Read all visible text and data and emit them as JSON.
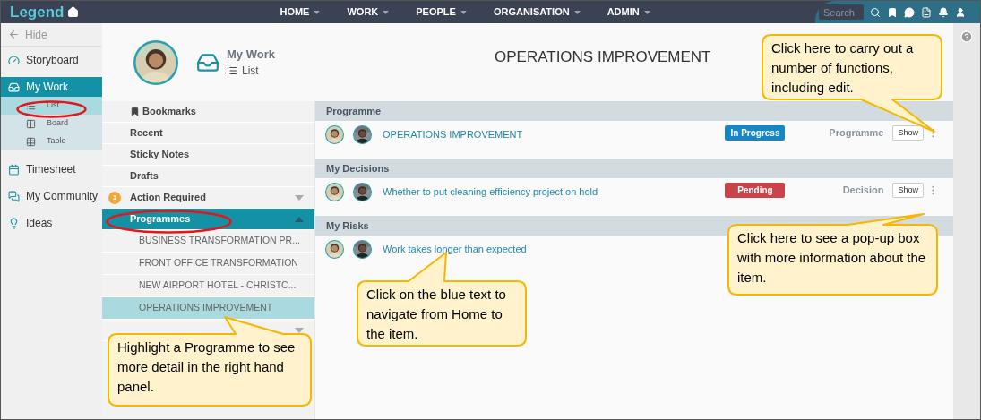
{
  "app": {
    "logo": "Legend"
  },
  "top_nav": [
    {
      "label": "HOME"
    },
    {
      "label": "WORK"
    },
    {
      "label": "PEOPLE"
    },
    {
      "label": "ORGANISATION"
    },
    {
      "label": "ADMIN"
    }
  ],
  "search": {
    "placeholder": "Search"
  },
  "sidebar": {
    "hide": "Hide",
    "items": [
      {
        "label": "Storyboard",
        "selected": false
      },
      {
        "label": "My Work",
        "selected": true,
        "children": [
          {
            "label": "List",
            "selected": true
          },
          {
            "label": "Board",
            "selected": false
          },
          {
            "label": "Table",
            "selected": false
          }
        ]
      },
      {
        "label": "Timesheet",
        "selected": false
      },
      {
        "label": "My Community",
        "selected": false
      },
      {
        "label": "Ideas",
        "selected": false
      }
    ]
  },
  "header": {
    "title": "My Work",
    "subtitle": "List",
    "page_title": "OPERATIONS IMPROVEMENT"
  },
  "nav_list": [
    {
      "kind": "bookmark",
      "label": "Bookmarks"
    },
    {
      "kind": "plain",
      "label": "Recent"
    },
    {
      "kind": "plain",
      "label": "Sticky Notes"
    },
    {
      "kind": "plain",
      "label": "Drafts"
    },
    {
      "kind": "group",
      "label": "Action Required",
      "badge": "1",
      "expanded": false,
      "selected": false
    },
    {
      "kind": "group",
      "label": "Programmes",
      "expanded": true,
      "selected": true,
      "children": [
        {
          "label": "BUSINESS TRANSFORMATION PR...",
          "selected": false
        },
        {
          "label": "FRONT OFFICE TRANSFORMATION",
          "selected": false
        },
        {
          "label": "NEW AIRPORT HOTEL - CHRISTC...",
          "selected": false
        },
        {
          "label": "OPERATIONS IMPROVEMENT",
          "selected": true
        }
      ]
    },
    {
      "kind": "group",
      "expanded": false,
      "selected": false
    }
  ],
  "sections": [
    {
      "title": "Programme",
      "rows": [
        {
          "title": "OPERATIONS IMPROVEMENT",
          "status": {
            "label": "In Progress",
            "color": "#1687c4"
          },
          "type": "Programme",
          "action": "Show",
          "menu": true
        }
      ]
    },
    {
      "title": "My Decisions",
      "rows": [
        {
          "title": "Whether to put cleaning efficiency project on hold",
          "status": {
            "label": "Pending",
            "color": "#c9444a"
          },
          "type": "Decision",
          "action": "Show",
          "menu": true
        }
      ]
    },
    {
      "title": "My Risks",
      "rows": [
        {
          "title": "Work takes longer than expected"
        }
      ]
    }
  ],
  "callouts": [
    {
      "text": "Click here to carry out a number of functions, including edit."
    },
    {
      "text": "Click here to see a pop-up box with more information about the item."
    },
    {
      "text": "Click on the blue text to navigate from Home to the item."
    },
    {
      "text": "Highlight a Programme to see more detail in the right hand panel."
    }
  ],
  "annotations": [
    {
      "kind": "ellipse"
    },
    {
      "kind": "ellipse"
    }
  ]
}
